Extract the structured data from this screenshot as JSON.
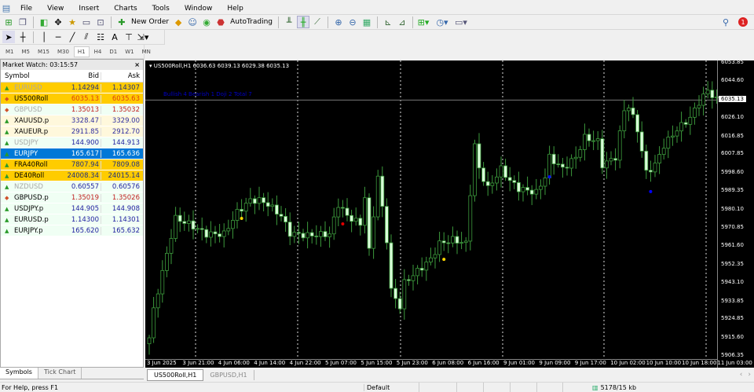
{
  "menu": [
    "File",
    "View",
    "Insert",
    "Charts",
    "Tools",
    "Window",
    "Help"
  ],
  "toolbar": {
    "new_order": "New Order",
    "auto_trading": "AutoTrading",
    "notification_count": "1"
  },
  "draw_tools": {
    "text_tool": "A"
  },
  "timeframes": [
    "M1",
    "M5",
    "M15",
    "M30",
    "H1",
    "H4",
    "D1",
    "W1",
    "MN"
  ],
  "active_timeframe": "H1",
  "market_watch": {
    "title": "Market Watch: 03:15:57",
    "close": "×",
    "headers": {
      "symbol": "Symbol",
      "bid": "Bid",
      "ask": "Ask"
    },
    "rows": [
      {
        "symbol": "EURUSD",
        "bid": "1.14294",
        "ask": "1.14307",
        "dir": "up",
        "style": "hl",
        "dim": true,
        "bidc": "#203080",
        "askc": "#203080"
      },
      {
        "symbol": "US500Roll",
        "bid": "6035.13",
        "ask": "6035.63",
        "dir": "down",
        "style": "hl",
        "dim": false,
        "bidc": "#e04010",
        "askc": "#e04010"
      },
      {
        "symbol": "GBPUSD",
        "bid": "1.35013",
        "ask": "1.35032",
        "dir": "down",
        "style": "mint",
        "dim": true,
        "bidc": "#c02020",
        "askc": "#c02020"
      },
      {
        "symbol": "XAUUSD.p",
        "bid": "3328.47",
        "ask": "3329.00",
        "dir": "up",
        "style": "cream",
        "dim": false,
        "bidc": "#3030a0",
        "askc": "#3030a0"
      },
      {
        "symbol": "XAUEUR.p",
        "bid": "2911.85",
        "ask": "2912.70",
        "dir": "up",
        "style": "cream",
        "dim": false,
        "bidc": "#3030a0",
        "askc": "#3030a0"
      },
      {
        "symbol": "USDJPY",
        "bid": "144.900",
        "ask": "144.913",
        "dir": "up",
        "style": "mint",
        "dim": true,
        "bidc": "#2020a0",
        "askc": "#2020a0"
      },
      {
        "symbol": "EURJPY",
        "bid": "165.617",
        "ask": "165.636",
        "dir": "up",
        "style": "sel",
        "dim": false,
        "bidc": "#ffffff",
        "askc": "#ffffff"
      },
      {
        "symbol": "FRA40Roll",
        "bid": "7807.94",
        "ask": "7809.08",
        "dir": "up",
        "style": "hl",
        "dim": false,
        "bidc": "#203080",
        "askc": "#203080"
      },
      {
        "symbol": "DE40Roll",
        "bid": "24008.34",
        "ask": "24015.14",
        "dir": "up",
        "style": "hl",
        "dim": false,
        "bidc": "#203080",
        "askc": "#203080"
      },
      {
        "symbol": "NZDUSD",
        "bid": "0.60557",
        "ask": "0.60576",
        "dir": "up",
        "style": "mint",
        "dim": true,
        "bidc": "#2020a0",
        "askc": "#2020a0"
      },
      {
        "symbol": "GBPUSD.p",
        "bid": "1.35019",
        "ask": "1.35026",
        "dir": "down",
        "style": "mint",
        "dim": false,
        "bidc": "#c02020",
        "askc": "#c02020"
      },
      {
        "symbol": "USDJPY.p",
        "bid": "144.905",
        "ask": "144.908",
        "dir": "up",
        "style": "mint",
        "dim": false,
        "bidc": "#2020a0",
        "askc": "#2020a0"
      },
      {
        "symbol": "EURUSD.p",
        "bid": "1.14300",
        "ask": "1.14301",
        "dir": "up",
        "style": "mint",
        "dim": false,
        "bidc": "#2020a0",
        "askc": "#2020a0"
      },
      {
        "symbol": "EURJPY.p",
        "bid": "165.620",
        "ask": "165.632",
        "dir": "up",
        "style": "mint",
        "dim": false,
        "bidc": "#2020a0",
        "askc": "#2020a0"
      }
    ],
    "tabs": [
      "Symbols",
      "Tick Chart"
    ]
  },
  "chart": {
    "header": "US500Roll,H1  6036.63 6039.13 6029.38 6035.13",
    "counts": "Bullish 4 Bearish 1 Doji 2 Total 7",
    "current_price": "6035.13",
    "price_labels": [
      "6053.85",
      "6044.60",
      "6035.13",
      "6026.10",
      "6016.85",
      "6007.85",
      "5998.60",
      "5989.35",
      "5980.10",
      "5970.85",
      "5961.60",
      "5952.35",
      "5943.10",
      "5933.85",
      "5924.85",
      "5915.60",
      "5906.35"
    ],
    "time_labels": [
      "3 Jun 2025",
      "3 Jun 21:00",
      "4 Jun 06:00",
      "4 Jun 14:00",
      "4 Jun 22:00",
      "5 Jun 07:00",
      "5 Jun 15:00",
      "5 Jun 23:00",
      "6 Jun 08:00",
      "6 Jun 16:00",
      "9 Jun 01:00",
      "9 Jun 09:00",
      "9 Jun 17:00",
      "10 Jun 02:00",
      "10 Jun 10:00",
      "10 Jun 18:00",
      "11 Jun 03:00"
    ]
  },
  "chart_data": {
    "type": "candlestick",
    "symbol": "US500Roll",
    "timeframe": "H1",
    "ylim": [
      5906.35,
      6053.85
    ],
    "bars": 130,
    "close_anchors": [
      [
        0,
        5915.5
      ],
      [
        1,
        5929.4
      ],
      [
        2,
        5939.2
      ],
      [
        5,
        5966.9
      ],
      [
        6,
        5975.6
      ],
      [
        9,
        5972.8
      ],
      [
        13,
        5967.7
      ],
      [
        17,
        5967.7
      ],
      [
        20,
        5978.7
      ],
      [
        23,
        5984.7
      ],
      [
        25,
        5984.7
      ],
      [
        27,
        5982.7
      ],
      [
        30,
        5976.8
      ],
      [
        32,
        5968.1
      ],
      [
        36,
        5967.0
      ],
      [
        41,
        5967.7
      ],
      [
        43,
        5982.7
      ],
      [
        45,
        5976.8
      ],
      [
        48,
        5972.8
      ],
      [
        49,
        5986.6
      ],
      [
        50,
        5959.0
      ],
      [
        52,
        5996.5
      ],
      [
        54,
        5964.9
      ],
      [
        55,
        5939.2
      ],
      [
        57,
        5931.3
      ],
      [
        58,
        5943.2
      ],
      [
        61,
        5949.1
      ],
      [
        64,
        5955.0
      ],
      [
        66,
        5962.9
      ],
      [
        69,
        5964.9
      ],
      [
        72,
        5962.9
      ],
      [
        73,
        5988.6
      ],
      [
        74,
        6012.3
      ],
      [
        75,
        6000.5
      ],
      [
        77,
        5990.6
      ],
      [
        80,
        6000.5
      ],
      [
        82,
        5994.5
      ],
      [
        84,
        5990.6
      ],
      [
        88,
        5988.6
      ],
      [
        90,
        5996.5
      ],
      [
        91,
        6006.4
      ],
      [
        94,
        6000.5
      ],
      [
        97,
        6006.4
      ],
      [
        99,
        6016.3
      ],
      [
        102,
        6014.3
      ],
      [
        103,
        6002.5
      ],
      [
        106,
        6006.4
      ],
      [
        108,
        6030.1
      ],
      [
        109,
        6032.1
      ],
      [
        111,
        6020.3
      ],
      [
        113,
        5998.6
      ],
      [
        115,
        6002.5
      ],
      [
        117,
        6012.3
      ],
      [
        120,
        6020.3
      ],
      [
        123,
        6026.2
      ],
      [
        125,
        6034.1
      ],
      [
        127,
        6040.0
      ],
      [
        129,
        6035.1
      ]
    ],
    "markers": [
      {
        "bar": 21,
        "price": 5975.6,
        "color": "#ffd700"
      },
      {
        "bar": 44,
        "price": 5972.8,
        "color": "#e00000"
      },
      {
        "bar": 67,
        "price": 5955.0,
        "color": "#ffd700"
      },
      {
        "bar": 91,
        "price": 5996.5,
        "color": "#0000ff"
      },
      {
        "bar": 114,
        "price": 5989.1,
        "color": "#0000ff"
      }
    ]
  },
  "chart_tabs": [
    "US500Roll,H1",
    "GBPUSD,H1"
  ],
  "status": {
    "help": "For Help, press F1",
    "profile": "Default",
    "traffic": "5178/15 kb"
  }
}
